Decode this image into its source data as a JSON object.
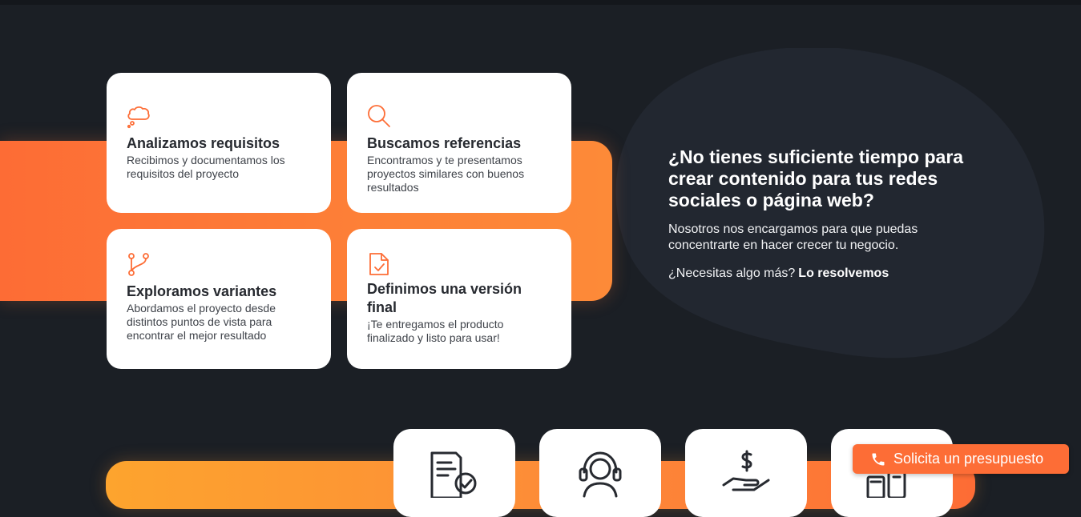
{
  "colors": {
    "background": "#1b1f25",
    "accent": "#fd6d36",
    "accent_light": "#fd8a38",
    "accent_yellow": "#fda42e",
    "card": "#ffffff",
    "heading_text": "#272a30"
  },
  "cards": [
    {
      "icon": "thought-bubble-icon",
      "title": "Analizamos requisitos",
      "description": "Recibimos y documentamos los requisitos del proyecto"
    },
    {
      "icon": "magnifier-icon",
      "title": "Buscamos referencias",
      "description": "Encontramos y te presentamos proyectos similares con buenos resultados"
    },
    {
      "icon": "branch-icon",
      "title": "Exploramos variantes",
      "description": "Abordamos el proyecto desde distintos puntos de vista para encontrar el mejor resultado"
    },
    {
      "icon": "document-check-icon",
      "title": "Definimos una versión final",
      "description": "¡Te entregamos el producto finalizado y listo para usar!"
    }
  ],
  "promo": {
    "heading": "¿No tienes suficiente tiempo para crear contenido para tus redes sociales o página web?",
    "body": "Nosotros nos encargamos para que puedas concentrarte en hacer crecer tu negocio.",
    "question": "¿Necesitas algo más?",
    "link_label": "Lo resolvemos"
  },
  "services": [
    {
      "icon": "document-check-icon"
    },
    {
      "icon": "support-agent-icon"
    },
    {
      "icon": "money-hand-icon"
    },
    {
      "icon": "devices-icon"
    }
  ],
  "cta": {
    "icon": "phone-icon",
    "label": "Solicita un presupuesto"
  }
}
